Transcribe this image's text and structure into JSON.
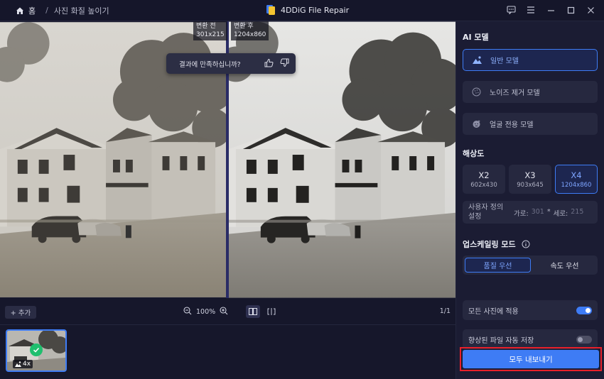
{
  "titlebar": {
    "home_label": "홈",
    "breadcrumb_sep": "/",
    "breadcrumb_page": "사진 화질 높이기",
    "app_title": "4DDiG File Repair"
  },
  "viewer": {
    "before_label": "변환 전",
    "before_size": "301x215",
    "after_label": "변환 후",
    "after_size": "1204x860",
    "feedback_question": "결과에 만족하십니까?"
  },
  "toolbar": {
    "add_label": "+ 추가",
    "zoom_level": "100%",
    "page_indicator": "1/1"
  },
  "thumbnail": {
    "scale_label": "4x",
    "status": "done"
  },
  "panel": {
    "ai_model_title": "AI 모델",
    "models": [
      {
        "label": "일반 모델",
        "icon": "landscape-icon",
        "active": true
      },
      {
        "label": "노이즈 제거 모델",
        "icon": "noise-icon",
        "active": false
      },
      {
        "label": "얼굴 전용 모델",
        "icon": "face-icon",
        "active": false
      }
    ],
    "resolution_title": "해상도",
    "resolutions": [
      {
        "scale": "X2",
        "size": "602x430",
        "active": false
      },
      {
        "scale": "X3",
        "size": "903x645",
        "active": false
      },
      {
        "scale": "X4",
        "size": "1204x860",
        "active": true
      }
    ],
    "custom_label": "사용자 정의 설정",
    "width_label": "가로:",
    "width_value": "301",
    "times_sign": "*",
    "height_label": "세로:",
    "height_value": "215",
    "upscale_mode_title": "업스케일링 모드",
    "mode_quality": "품질 우선",
    "mode_speed": "속도 우선",
    "apply_all_label": "모든 사진에 적용",
    "apply_all_on": true,
    "autosave_label": "향상된 파일 자동 저장",
    "autosave_on": false,
    "export_all_label": "모두 내보내기"
  },
  "colors": {
    "accent": "#3e7cf5",
    "highlight_border": "#e8202a",
    "success": "#1fbf6e"
  }
}
